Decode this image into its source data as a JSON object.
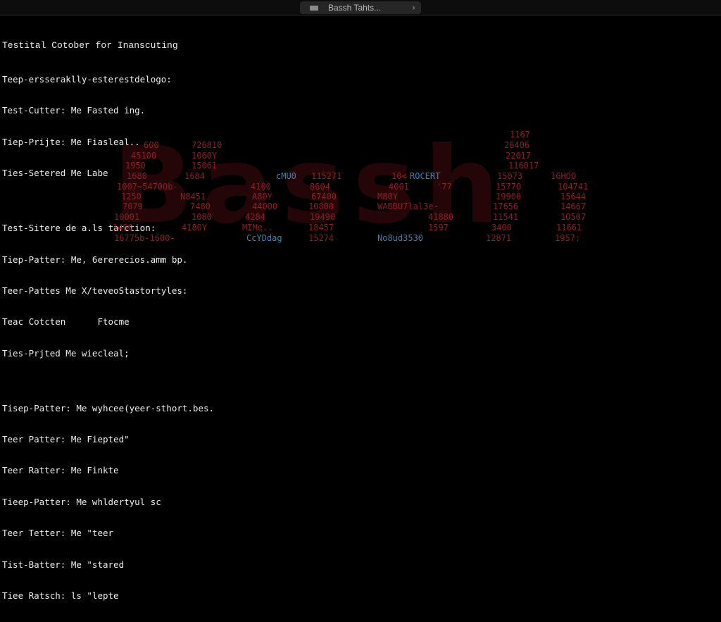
{
  "window": {
    "tab_title": "Bassh Tahts...",
    "tab_icon": "terminal-icon",
    "tab_chevron": "›"
  },
  "terminal": {
    "heading": "Testital Cotober for Inanscuting",
    "block1": [
      "Teep-ersseraklly-esterestdelogo:",
      "Test-Cutter: Me Fasted ing.",
      "Tiep-Prijte: Me Fiasleal..",
      "Ties-Setered Me Labe"
    ],
    "block2": [
      "Test-Sitere de a.ls tarction:",
      "Tiep-Patter: Me, 6ererecios.amm bp.",
      "Teer-Pattes Me X/teveoStastortyles:",
      "Teac Cotcten      Ftocme",
      "Ties-Prjted Me wiecleal;"
    ],
    "block3": [
      "Tisep-Patter: Me wyhcee(yeer-sthort.bes.",
      "Teer Patter: Me Fiepted\"",
      "Teer Ratter: Me Finkte",
      "Tieep-Patter: Me whldertyul sc",
      "Teer Tetter: Me \"teer",
      "Tist-Batter: Me \"stared",
      "Tiee Ratsch: ls \"lepte"
    ],
    "watermark": "Bassh",
    "scattered": [
      {
        "text": "1167",
        "color": "red"
      },
      {
        "text": "600",
        "color": "red"
      },
      {
        "text": "726810",
        "color": "red"
      },
      {
        "text": "26406",
        "color": "red"
      },
      {
        "text": "45100",
        "color": "red"
      },
      {
        "text": "1060Y",
        "color": "red"
      },
      {
        "text": "22017",
        "color": "red"
      },
      {
        "text": "1950",
        "color": "red"
      },
      {
        "text": "15061",
        "color": "red"
      },
      {
        "text": "116017",
        "color": "red"
      },
      {
        "text": "1680",
        "color": "red"
      },
      {
        "text": "1684",
        "color": "red"
      },
      {
        "text": "cMU0",
        "color": "blue"
      },
      {
        "text": "115271",
        "color": "red"
      },
      {
        "text": "10<",
        "color": "red"
      },
      {
        "text": "ROCERT",
        "color": "blue"
      },
      {
        "text": "15073",
        "color": "red"
      },
      {
        "text": "1GHOO",
        "color": "red"
      },
      {
        "text": "1007~5470Ob-",
        "color": "red"
      },
      {
        "text": "4100",
        "color": "red"
      },
      {
        "text": "8604",
        "color": "red"
      },
      {
        "text": "4001",
        "color": "red"
      },
      {
        "text": "'77",
        "color": "red"
      },
      {
        "text": "1577O",
        "color": "red"
      },
      {
        "text": "104741",
        "color": "red"
      },
      {
        "text": "1250",
        "color": "red"
      },
      {
        "text": "N8451",
        "color": "red"
      },
      {
        "text": "A80Y",
        "color": "red"
      },
      {
        "text": "67400",
        "color": "red"
      },
      {
        "text": "M80Y",
        "color": "red"
      },
      {
        "text": "19900",
        "color": "red"
      },
      {
        "text": "15644",
        "color": "red"
      },
      {
        "text": "7079",
        "color": "red"
      },
      {
        "text": "7480",
        "color": "red"
      },
      {
        "text": "44000",
        "color": "red"
      },
      {
        "text": "10800",
        "color": "red"
      },
      {
        "text": "WABBU7lal3e-",
        "color": "red"
      },
      {
        "text": "17656",
        "color": "red"
      },
      {
        "text": "14667",
        "color": "red"
      },
      {
        "text": "10001",
        "color": "red"
      },
      {
        "text": "1080",
        "color": "red"
      },
      {
        "text": "4284",
        "color": "red"
      },
      {
        "text": "19490",
        "color": "red"
      },
      {
        "text": "41880",
        "color": "red"
      },
      {
        "text": "11541",
        "color": "red"
      },
      {
        "text": "1O507",
        "color": "red"
      },
      {
        "text": "1490",
        "color": "red"
      },
      {
        "text": "4180Y",
        "color": "red"
      },
      {
        "text": "MIMe..",
        "color": "red"
      },
      {
        "text": "18457",
        "color": "red"
      },
      {
        "text": "1597",
        "color": "red"
      },
      {
        "text": "3400",
        "color": "red"
      },
      {
        "text": "11661",
        "color": "red"
      },
      {
        "text": "16775b-1600-",
        "color": "red"
      },
      {
        "text": "CcYDdag",
        "color": "blue"
      },
      {
        "text": "15274",
        "color": "red"
      },
      {
        "text": "No8ud3530",
        "color": "blue"
      },
      {
        "text": "12871",
        "color": "red"
      },
      {
        "text": "1957:",
        "color": "red"
      }
    ]
  }
}
